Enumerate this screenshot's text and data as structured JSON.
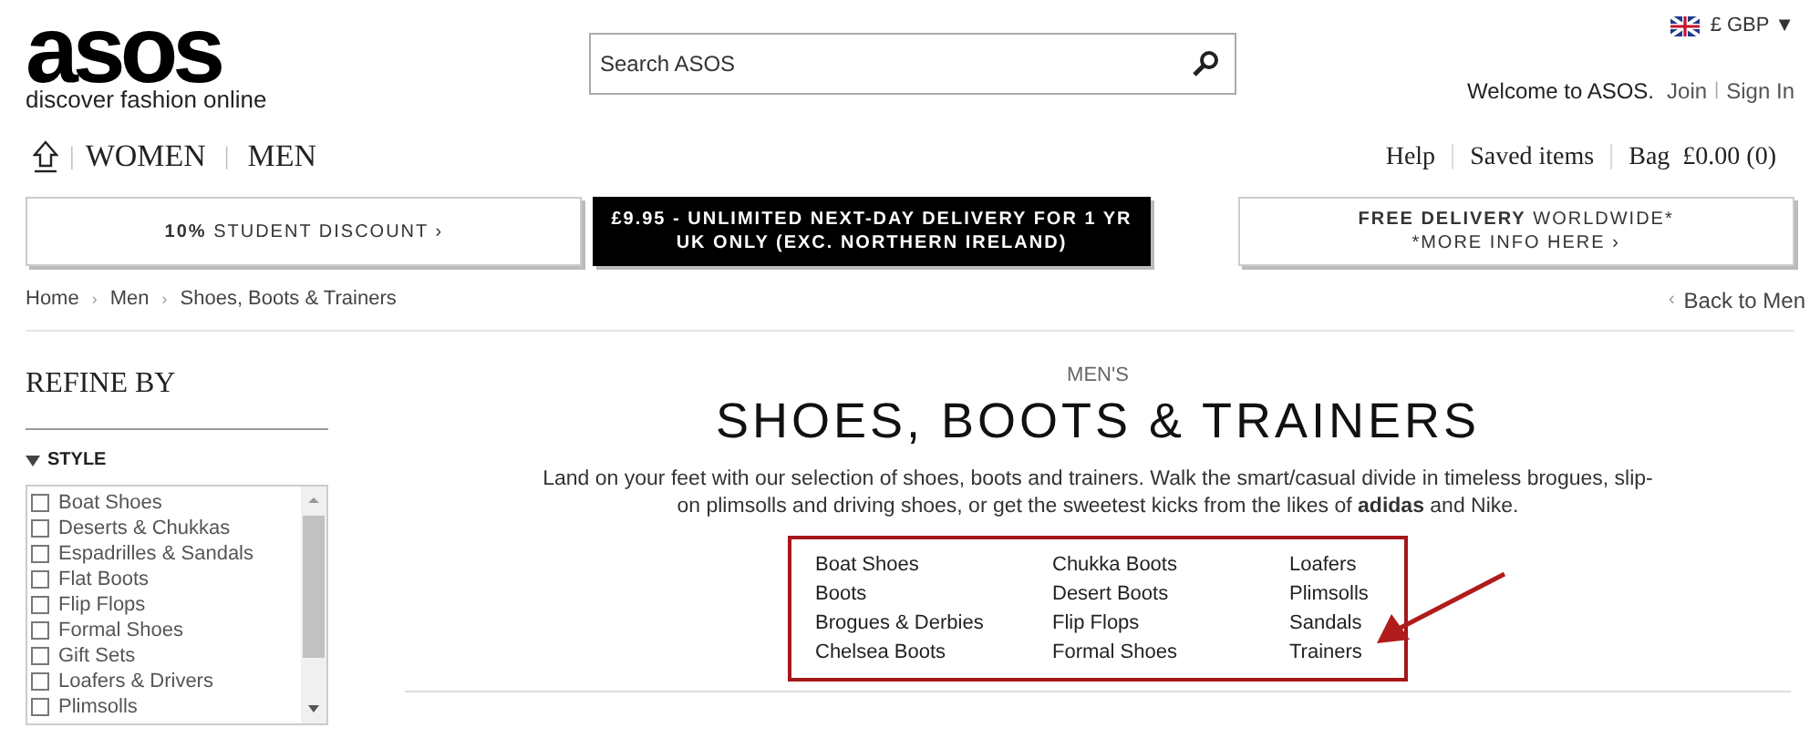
{
  "logo": {
    "wordmark": "asos",
    "tagline": "discover fashion online"
  },
  "search": {
    "placeholder": "Search ASOS"
  },
  "currency": {
    "label": "£ GBP",
    "caret": "▼"
  },
  "account": {
    "welcome": "Welcome to ASOS.",
    "links": [
      "Join",
      "Sign In"
    ],
    "separator": "|"
  },
  "nav": {
    "items": [
      {
        "label": "WOMEN",
        "selected": false
      },
      {
        "label": "MEN",
        "selected": false
      }
    ],
    "separator": "|"
  },
  "utility": [
    {
      "label": "Help"
    },
    {
      "label": "Saved items"
    },
    {
      "label": "Bag  £0.00 (0)"
    }
  ],
  "banners": [
    {
      "kind": "light",
      "lines": [
        {
          "bold": "10%",
          "rest": "STUDENT DISCOUNT ›"
        }
      ]
    },
    {
      "kind": "dark",
      "lines": [
        {
          "bold": "£9.95 - UNLIMITED NEXT-DAY DELIVERY FOR 1 YR"
        },
        {
          "bold": "UK ONLY (EXC. NORTHERN IRELAND)"
        }
      ]
    },
    {
      "kind": "light",
      "lines": [
        {
          "bold": "FREE DELIVERY",
          "rest": "WORLDWIDE*"
        },
        {
          "rest": "*MORE INFO HERE ›"
        }
      ]
    }
  ],
  "breadcrumb": {
    "items": [
      "Home",
      "Men",
      "Shoes, Boots & Trainers"
    ],
    "separator": "›"
  },
  "back_link": {
    "arrow": "‹",
    "label": "Back to Men"
  },
  "sidebar": {
    "title": "REFINE BY",
    "section": {
      "label": "STYLE",
      "expanded": true,
      "items": [
        {
          "label": "Boat Shoes",
          "checked": false
        },
        {
          "label": "Deserts & Chukkas",
          "checked": false
        },
        {
          "label": "Espadrilles & Sandals",
          "checked": false
        },
        {
          "label": "Flat Boots",
          "checked": false
        },
        {
          "label": "Flip Flops",
          "checked": false
        },
        {
          "label": "Formal Shoes",
          "checked": false
        },
        {
          "label": "Gift Sets",
          "checked": false
        },
        {
          "label": "Loafers & Drivers",
          "checked": false
        },
        {
          "label": "Plimsolls",
          "checked": false
        }
      ]
    }
  },
  "main": {
    "kicker": "MEN'S",
    "title": "SHOES, BOOTS & TRAINERS",
    "intro": "Land on your feet with our selection of shoes, boots and trainers. Walk the smart/casual divide in timeless brogues, slip-on plimsolls and driving shoes, or get the sweetest kicks from the likes of **adidas** and Nike.",
    "categories": [
      [
        "Boat Shoes",
        "Boots",
        "Brogues & Derbies",
        "Chelsea Boots"
      ],
      [
        "Chukka Boots",
        "Desert Boots",
        "Flip Flops",
        "Formal Shoes"
      ],
      [
        "Loafers",
        "Plimsolls",
        "Sandals",
        "Trainers"
      ]
    ]
  }
}
